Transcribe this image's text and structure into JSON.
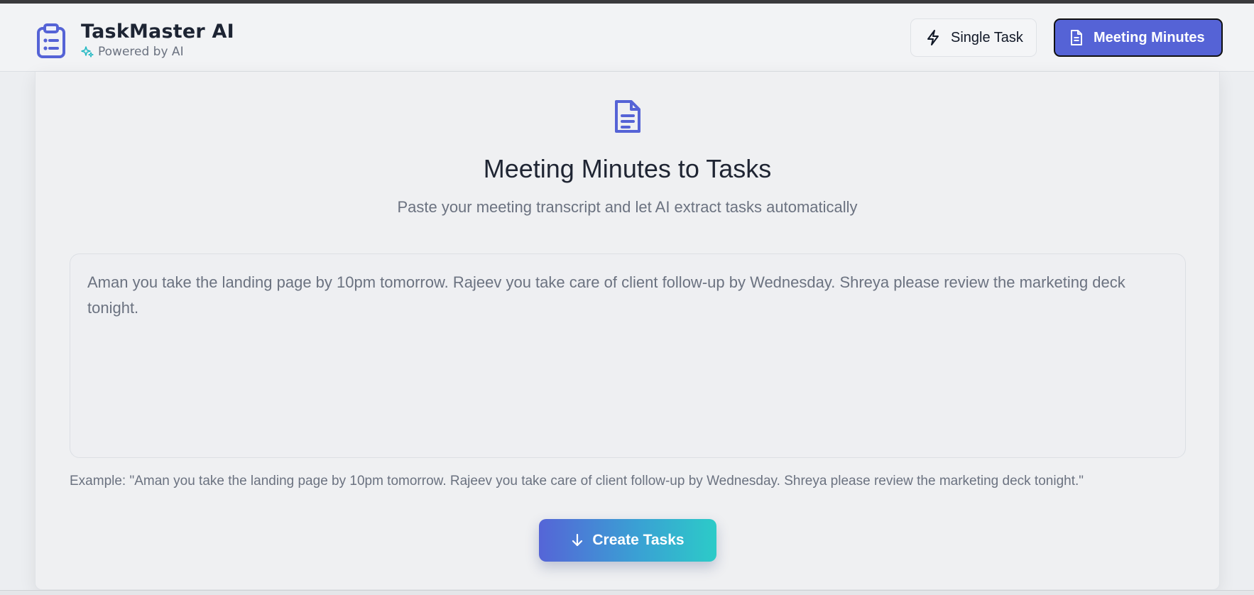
{
  "app": {
    "title": "TaskMaster AI",
    "subtitle": "Powered by AI",
    "brand_icon": "clipboard-list-icon",
    "subtitle_icon": "sparkles-icon"
  },
  "nav": {
    "single_task_label": "Single Task",
    "single_task_icon": "lightning-icon",
    "meeting_minutes_label": "Meeting Minutes",
    "meeting_minutes_icon": "document-icon",
    "active": "Meeting Minutes"
  },
  "main": {
    "icon": "document-icon",
    "title": "Meeting Minutes to Tasks",
    "subtitle": "Paste your meeting transcript and let AI extract tasks automatically",
    "transcript_value": "Aman you take the landing page by 10pm tomorrow. Rajeev you take care of client follow-up by Wednesday. Shreya please review the marketing deck tonight.",
    "example": "Example: \"Aman you take the landing page by 10pm tomorrow. Rajeev you take care of client follow-up by Wednesday. Shreya please review the marketing deck tonight.\"",
    "create_button_label": "Create Tasks",
    "create_button_icon": "arrow-down-icon"
  },
  "colors": {
    "accent": "#5563d6",
    "accent_teal": "#2ccbc8",
    "background": "#eceef1",
    "text_muted": "#6b7280"
  }
}
